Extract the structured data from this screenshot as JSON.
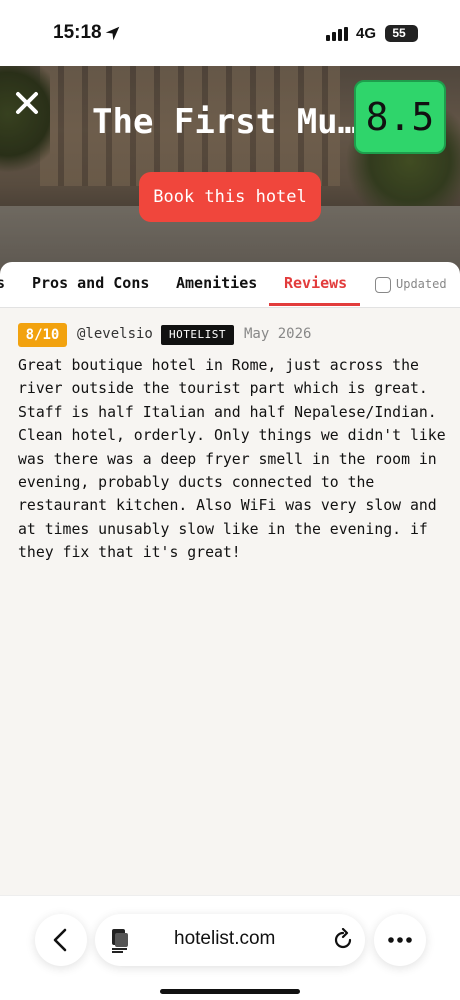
{
  "status_bar": {
    "time": "15:18",
    "network": "4G",
    "battery": "55",
    "icons": [
      "location-arrow-icon",
      "signal-bars-icon",
      "battery-icon"
    ]
  },
  "hero": {
    "title": "The First Mu…",
    "score": "8.5",
    "book_label": "Book this hotel",
    "close_icon": "close-icon"
  },
  "tabs": {
    "partial": "s",
    "items": [
      "Pros and Cons",
      "Amenities",
      "Reviews"
    ],
    "active": "Reviews",
    "updated_label": "Updated"
  },
  "review": {
    "rating": "8/10",
    "user": "@levelsio",
    "badge": "HOTELIST",
    "date": "May 2026",
    "text": "Great boutique hotel in Rome, just across the\nriver outside the tourist part which is great.\nStaff is half Italian and half Nepalese/Indian.\nClean hotel, orderly. Only things we didn't like\nwas there was a deep fryer smell in the room in\nevening, probably ducts connected to the\nrestaurant kitchen. Also WiFi was very slow and\nat times unusably slow like in the evening. if\nthey fix that it's great!"
  },
  "browser": {
    "url": "hotelist.com",
    "icons": [
      "back-chevron-icon",
      "page-icon",
      "reload-icon",
      "more-dots-icon"
    ]
  },
  "colors": {
    "accent_red": "#f0463c",
    "score_green": "#2fd56b",
    "rating_orange": "#f2a20f"
  }
}
